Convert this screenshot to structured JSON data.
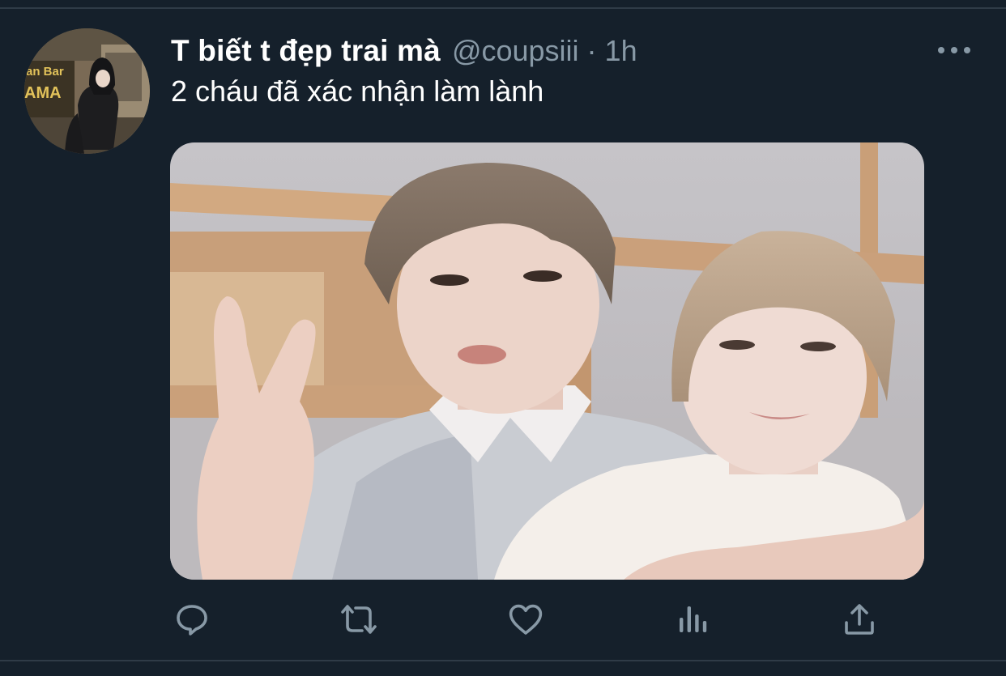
{
  "tweet": {
    "display_name": "T biết t đẹp trai mà",
    "handle": "@coupsiii",
    "separator": "·",
    "time": "1h",
    "text": "2 cháu đã xác nhận làm lành",
    "avatar_sign_text": [
      "an Bar",
      "AMA"
    ]
  },
  "actions": {
    "reply_icon": "reply-icon",
    "retweet_icon": "retweet-icon",
    "like_icon": "heart-icon",
    "analytics_icon": "analytics-icon",
    "share_icon": "share-icon"
  },
  "colors": {
    "background": "#15202b",
    "secondary_text": "#8899a6",
    "primary_text": "#ffffff"
  }
}
